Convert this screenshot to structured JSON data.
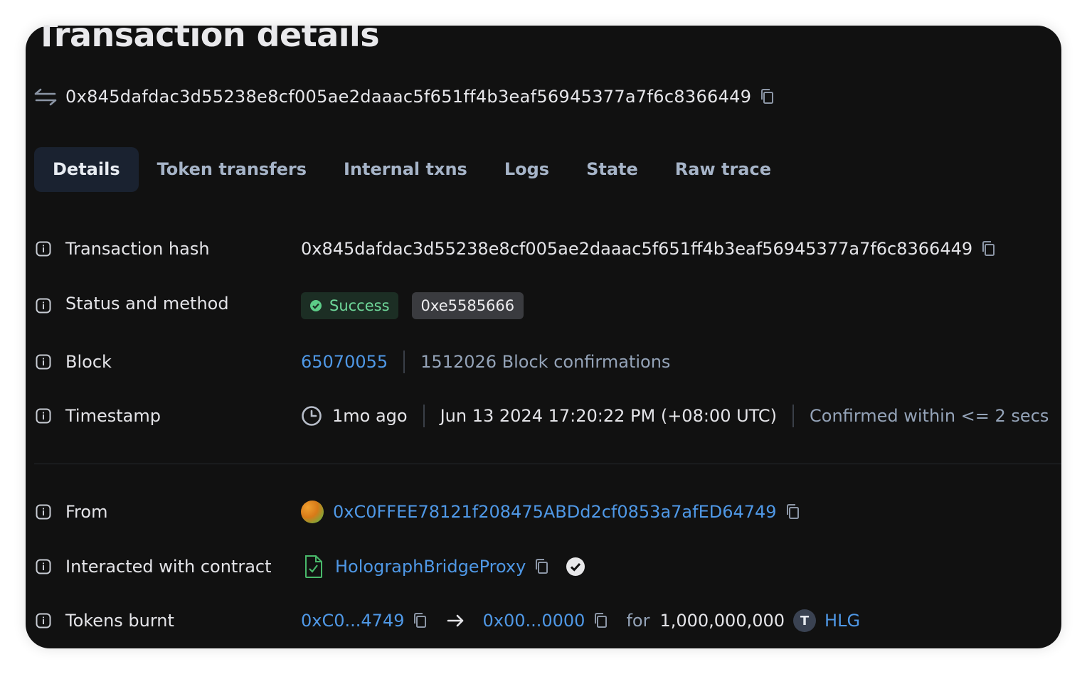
{
  "page": {
    "title": "Transaction details",
    "hash": "0x845dafdac3d55238e8cf005ae2daaac5f651ff4b3eaf56945377a7f6c8366449"
  },
  "tabs": [
    "Details",
    "Token transfers",
    "Internal txns",
    "Logs",
    "State",
    "Raw trace"
  ],
  "details": {
    "tx_hash": {
      "label": "Transaction hash",
      "value": "0x845dafdac3d55238e8cf005ae2daaac5f651ff4b3eaf56945377a7f6c8366449"
    },
    "status": {
      "label": "Status and method",
      "status": "Success",
      "method": "0xe5585666"
    },
    "block": {
      "label": "Block",
      "number": "65070055",
      "confirmations": "1512026 Block confirmations"
    },
    "timestamp": {
      "label": "Timestamp",
      "relative": "1mo ago",
      "absolute": "Jun 13 2024 17:20:22 PM (+08:00 UTC)",
      "confirmed": "Confirmed within <= 2 secs"
    },
    "from": {
      "label": "From",
      "address": "0xC0FFEE78121f208475ABDd2cf0853a7afED64749"
    },
    "contract": {
      "label": "Interacted with contract",
      "name": "HolographBridgeProxy"
    },
    "tokens_burnt": {
      "label": "Tokens burnt",
      "from": "0xC0...4749",
      "to": "0x00...0000",
      "for_label": "for",
      "amount": "1,000,000,000",
      "token_icon": "T",
      "token": "HLG"
    }
  },
  "colors": {
    "background": "#111111",
    "link": "#4f98e6",
    "success": "#6fd89a",
    "muted": "#94a3b8"
  }
}
